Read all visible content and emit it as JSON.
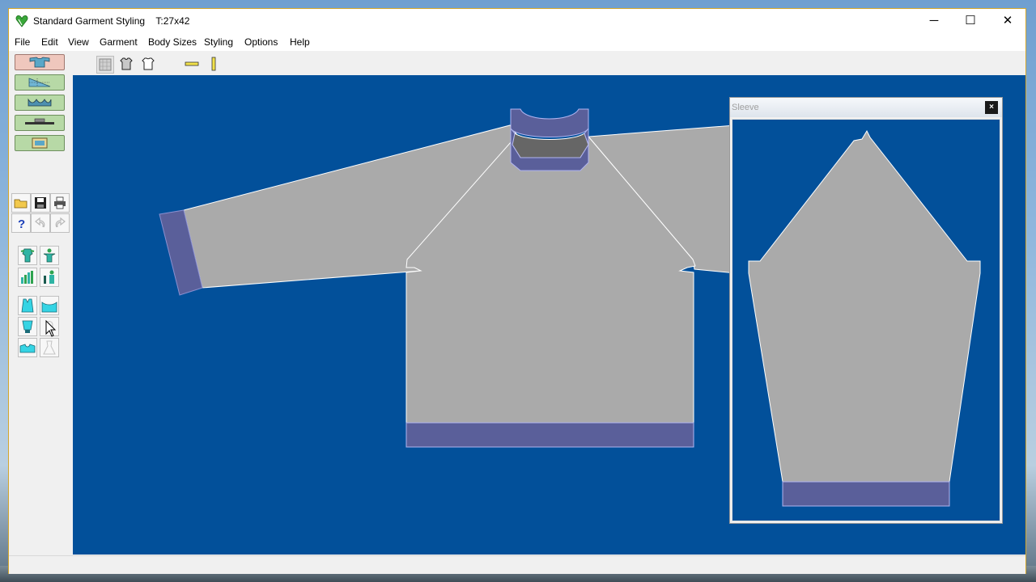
{
  "window": {
    "title": "Standard Garment Styling",
    "subtitle": "T:27x42",
    "minimize": "─",
    "maximize": "☐",
    "close": "✕"
  },
  "menu": [
    "File",
    "Edit",
    "View",
    "Garment",
    "Body Sizes",
    "Styling",
    "Options",
    "Help"
  ],
  "toolbar": [
    "grid-view-icon",
    "front-garment-icon",
    "back-garment-icon",
    "horizontal-ruler-icon",
    "vertical-ruler-icon"
  ],
  "side_modes": [
    "sweater-mode-icon",
    "shaping-mode-icon",
    "pattern-mode-icon",
    "knit-mode-icon",
    "picture-mode-icon"
  ],
  "sleeve_window": {
    "title": "Sleeve",
    "close": "×"
  },
  "colors": {
    "canvas": "#02509a",
    "garment": "#aaaaaa",
    "rib": "#5a5f9a",
    "neck_inner": "#666666"
  }
}
